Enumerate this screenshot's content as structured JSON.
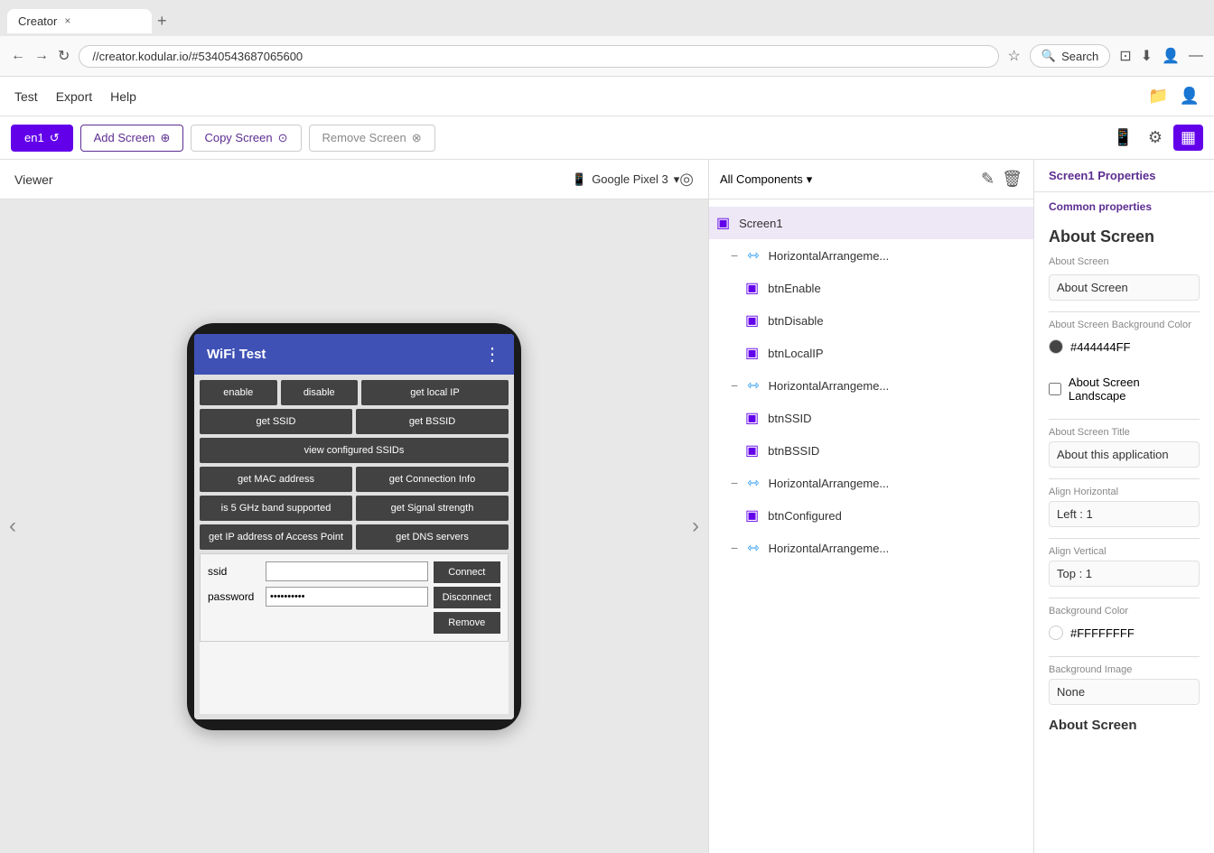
{
  "browser": {
    "tab_title": "Creator",
    "tab_close": "×",
    "tab_new": "+",
    "url": "//creator.kodular.io/#5340543687065600",
    "star_icon": "☆",
    "search_placeholder": "Search",
    "download_icon": "⬇",
    "pocket_icon": "⊡",
    "minimize_icon": "—"
  },
  "app_nav": {
    "test_label": "Test",
    "export_label": "Export",
    "help_label": "Help"
  },
  "screen_toolbar": {
    "screen1_label": "en1",
    "add_screen_label": "Add Screen",
    "copy_screen_label": "Copy Screen",
    "remove_screen_label": "Remove Screen"
  },
  "viewer": {
    "label": "Viewer",
    "device_name": "Google Pixel 3",
    "chevron_down": "▾",
    "hide_icon": "◎"
  },
  "phone": {
    "app_title": "WiFi Test",
    "menu_icon": "⋮",
    "buttons": [
      {
        "label": "enable",
        "type": "normal"
      },
      {
        "label": "disable",
        "type": "normal"
      },
      {
        "label": "get local IP",
        "type": "wide"
      }
    ],
    "row2": [
      {
        "label": "get SSID",
        "type": "normal"
      },
      {
        "label": "get BSSID",
        "type": "normal"
      }
    ],
    "row3": [
      {
        "label": "view configured SSIDs",
        "type": "full"
      }
    ],
    "row4": [
      {
        "label": "get MAC address",
        "type": "normal"
      },
      {
        "label": "get Connection Info",
        "type": "normal"
      }
    ],
    "row5": [
      {
        "label": "is 5 GHz band supported",
        "type": "normal"
      },
      {
        "label": "get Signal strength",
        "type": "normal"
      }
    ],
    "row6": [
      {
        "label": "get IP address of Access Point",
        "type": "normal"
      },
      {
        "label": "get DNS servers",
        "type": "normal"
      }
    ],
    "ssid_label": "ssid",
    "password_label": "password",
    "password_value": "••••••••••",
    "connect_btn": "Connect",
    "disconnect_btn": "Disconnect",
    "remove_btn": "Remove"
  },
  "components": {
    "header_label": "All Components",
    "chevron_down": "▾",
    "edit_icon": "✎",
    "delete_icon": "🗑",
    "items": [
      {
        "id": "screen1",
        "name": "Screen1",
        "level": "root",
        "type": "screen",
        "selected": true,
        "toggle": null
      },
      {
        "id": "horiz1",
        "name": "HorizontalArrangeme...",
        "level": "level1",
        "type": "horiz",
        "toggle": "−"
      },
      {
        "id": "btnEnable",
        "name": "btnEnable",
        "level": "level2",
        "type": "component",
        "toggle": null
      },
      {
        "id": "btnDisable",
        "name": "btnDisable",
        "level": "level2",
        "type": "component",
        "toggle": null
      },
      {
        "id": "btnLocalIP",
        "name": "btnLocalIP",
        "level": "level2",
        "type": "component",
        "toggle": null
      },
      {
        "id": "horiz2",
        "name": "HorizontalArrangeme...",
        "level": "level1",
        "type": "horiz",
        "toggle": "−"
      },
      {
        "id": "btnSSID",
        "name": "btnSSID",
        "level": "level2",
        "type": "component",
        "toggle": null
      },
      {
        "id": "btnBSSID",
        "name": "btnBSSID",
        "level": "level2",
        "type": "component",
        "toggle": null
      },
      {
        "id": "horiz3",
        "name": "HorizontalArrangeme...",
        "level": "level1",
        "type": "horiz",
        "toggle": "−"
      },
      {
        "id": "btnConfigured",
        "name": "btnConfigured",
        "level": "level2",
        "type": "component",
        "toggle": null
      },
      {
        "id": "horiz4",
        "name": "HorizontalArrangeme...",
        "level": "level1",
        "type": "horiz",
        "toggle": "−"
      }
    ]
  },
  "properties": {
    "title": "Screen1 Properties",
    "common_label": "Common properties",
    "about_screen_heading": "About Screen",
    "about_screen_section_label": "About Screen",
    "about_screen_bg_label": "About Screen Background Color",
    "about_screen_bg_color": "#444444FF",
    "about_screen_landscape_label": "About Screen Landscape",
    "about_screen_title_label": "About Screen Title",
    "about_screen_title_value": "About this application",
    "align_horizontal_label": "Align Horizontal",
    "align_horizontal_value": "Left : 1",
    "align_vertical_label": "Align Vertical",
    "align_vertical_value": "Top : 1",
    "bg_color_label": "Background Color",
    "bg_color_value": "#FFFFFFFF",
    "bg_image_label": "Background Image",
    "bg_image_value": "None",
    "about_screen_480_label": "About Screen",
    "about_screen_480_heading": "About Screen"
  }
}
